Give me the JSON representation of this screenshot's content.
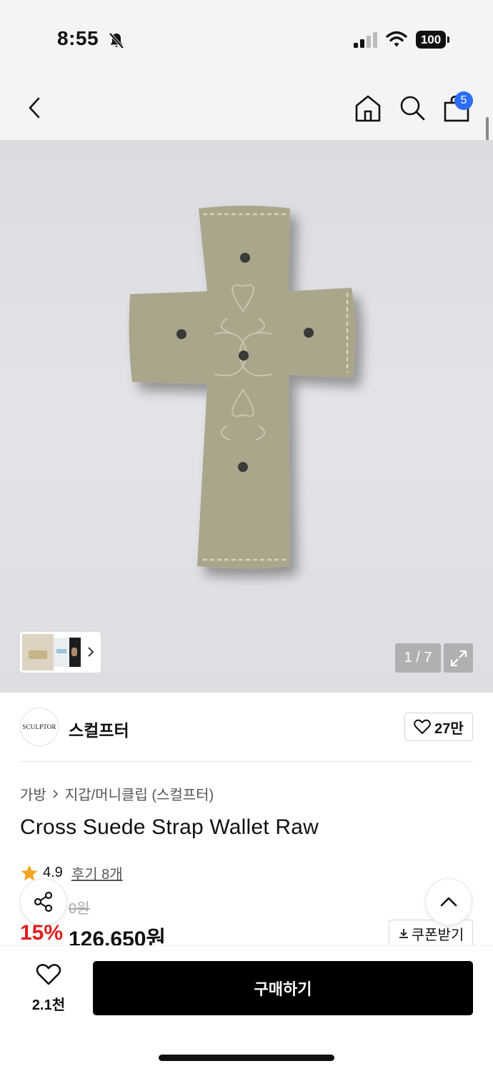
{
  "status_bar": {
    "time": "8:55",
    "battery": "100"
  },
  "nav": {
    "cart_count": "5"
  },
  "gallery": {
    "counter": "1 / 7"
  },
  "brand": {
    "logo_text": "SCULPTOR",
    "name": "스컬프터",
    "likes": "27만"
  },
  "breadcrumb": {
    "category": "가방",
    "subcategory": "지갑/머니클립 (스컬프터)"
  },
  "product": {
    "title": "Cross Suede Strap Wallet Raw",
    "rating": "4.9",
    "review_label": "후기 8개",
    "original_price": "0원",
    "discount": "15%",
    "sale_price": "126,650원",
    "coupon_label": "쿠폰받기"
  },
  "bottom_bar": {
    "wish_count": "2.1천",
    "buy_label": "구매하기"
  },
  "colors": {
    "accent_blue": "#2b6ef5",
    "discount_red": "#e01e1e",
    "star": "#f5a623",
    "buy_bg": "#000000"
  },
  "icons": [
    "bell-slash-icon",
    "signal-icon",
    "wifi-icon",
    "back-icon",
    "home-icon",
    "search-icon",
    "bag-icon",
    "chevron-right-icon",
    "expand-icon",
    "heart-icon",
    "star-icon",
    "share-icon",
    "chevron-up-icon",
    "download-icon"
  ]
}
